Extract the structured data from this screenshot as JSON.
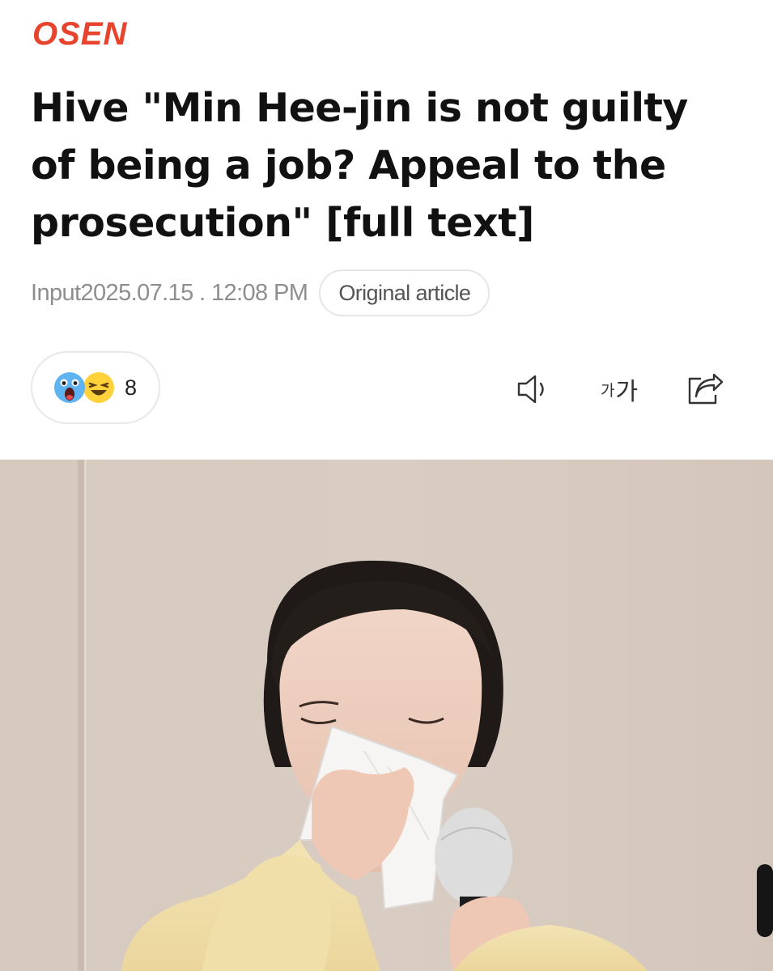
{
  "brand": {
    "logo_text": "OSEN",
    "accent_color": "#e8432d"
  },
  "article": {
    "headline": "Hive \"Min Hee-jin is not guilty of being a job? Appeal to the prosecution\" [full text]",
    "input_date": "Input2025.07.15 . 12:08 PM",
    "original_article_label": "Original article"
  },
  "reactions": {
    "icons": [
      "surprised-face-icon",
      "laughing-face-icon"
    ],
    "count": "8"
  },
  "toolbar": {
    "speaker_icon": "speaker-icon",
    "font_size_label_small": "가",
    "font_size_label_large": "가",
    "share_icon": "share-icon"
  },
  "photo": {
    "subject": "woman-wiping-tears-with-tissue-at-press-conference"
  }
}
